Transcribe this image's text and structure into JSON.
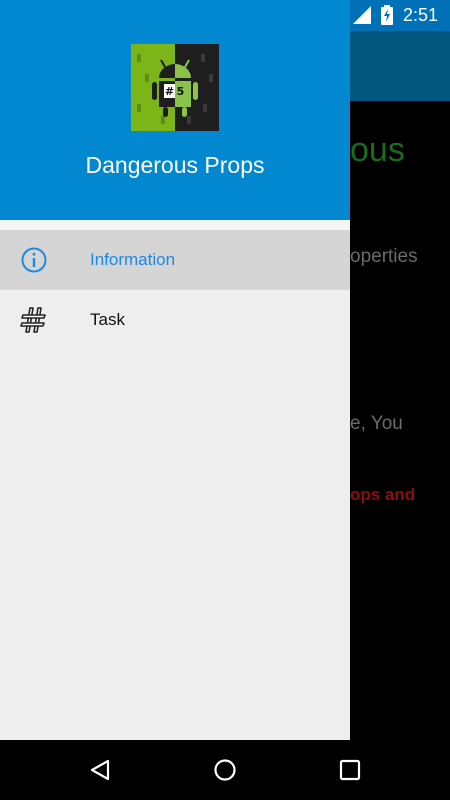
{
  "status_bar": {
    "time": "2:51",
    "notification_icon": "a-notification-icon",
    "wifi_icon": "wifi-icon",
    "signal_icon": "cell-signal-icon",
    "battery_icon": "battery-charging-icon"
  },
  "background_app": {
    "title_fragment": "ous",
    "line1_fragment": "operties",
    "line2_fragment": "e, You",
    "line3_fragment": "ops and"
  },
  "drawer": {
    "app_name": "Dangerous Props",
    "logo_text": "#5",
    "logo_icon": "android-hash5-logo",
    "items": [
      {
        "label": "Information",
        "icon": "info-icon",
        "active": true
      },
      {
        "label": "Task",
        "icon": "hash-icon",
        "active": false
      }
    ]
  },
  "nav_bar": {
    "back": "back-icon",
    "home": "home-icon",
    "recents": "recents-icon"
  },
  "colors": {
    "header_blue": "#0288d1",
    "status_blue": "#0171b7",
    "active_item_text": "#1e88e5",
    "drawer_bg": "#eeeeee"
  }
}
